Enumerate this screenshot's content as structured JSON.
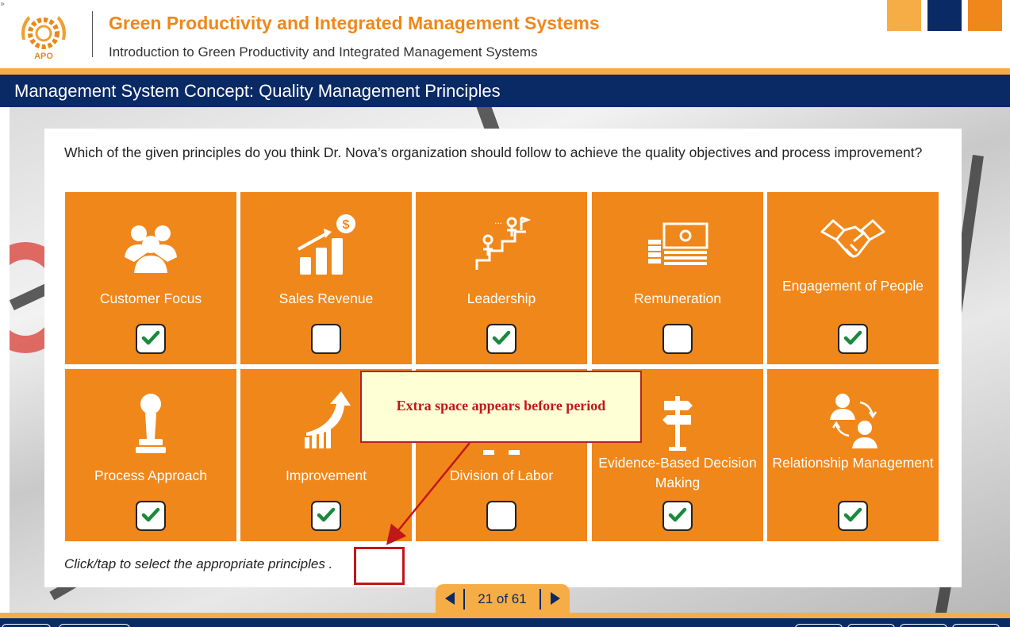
{
  "header": {
    "corner_mark": "»",
    "logo_text": "APO",
    "course_title": "Green Productivity and Integrated Management Systems",
    "course_subtitle": "Introduction to Green Productivity and Integrated Management Systems"
  },
  "page_title": "Management System Concept: Quality Management Principles",
  "question": "Which of the given principles do you think Dr. Nova’s organization should follow to achieve the quality objectives and process improvement?",
  "tiles": [
    {
      "label": "Customer Focus",
      "icon": "people-group-icon",
      "checked": true
    },
    {
      "label": "Sales Revenue",
      "icon": "revenue-chart-icon",
      "checked": false
    },
    {
      "label": "Leadership",
      "icon": "leadership-stairs-icon",
      "checked": true
    },
    {
      "label": "Remuneration",
      "icon": "money-icon",
      "checked": false
    },
    {
      "label": "Engagement of People",
      "icon": "handshake-icon",
      "checked": true
    },
    {
      "label": "Process Approach",
      "icon": "chess-pawn-icon",
      "checked": true
    },
    {
      "label": "Improvement",
      "icon": "growth-arrow-icon",
      "checked": true
    },
    {
      "label": "Division of Labor",
      "icon": "division-icon",
      "checked": false
    },
    {
      "label": "Evidence-Based Decision Making",
      "icon": "signpost-icon",
      "checked": true
    },
    {
      "label": "Relationship Management",
      "icon": "relationship-icon",
      "checked": true
    }
  ],
  "instruction": "Click/tap to select the appropriate principles .",
  "callout": {
    "text": "Extra space appears before period"
  },
  "pager": {
    "counter": "21 of 61"
  },
  "colors": {
    "orange": "#f0871a",
    "light_orange": "#f7ad45",
    "navy": "#0a2a66",
    "check_green": "#1a8a3a",
    "callout_red": "#c0171a"
  }
}
